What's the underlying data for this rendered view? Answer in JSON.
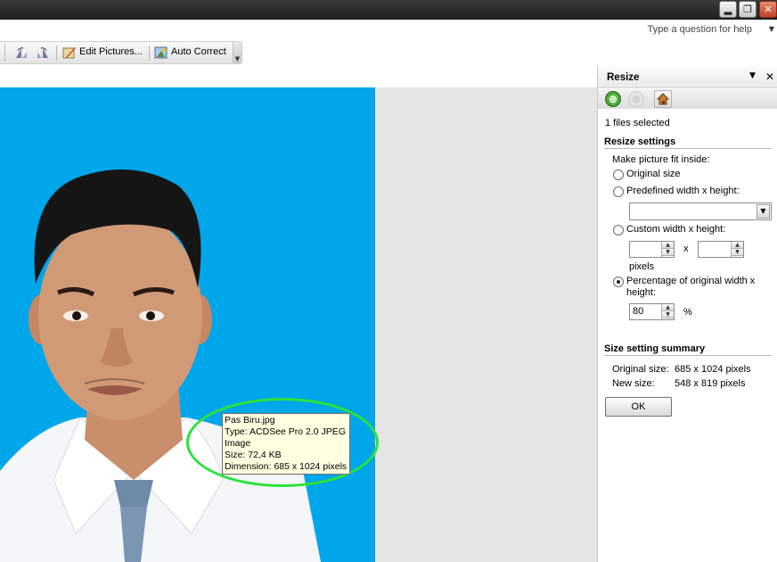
{
  "window": {
    "minimize_glyph": "▂",
    "restore_glyph": "❐",
    "close_glyph": "✕",
    "close_color": "#c5402a"
  },
  "menu": {
    "help_placeholder": "Type a question for help",
    "help_dropdown_glyph": "▼"
  },
  "toolbar": {
    "edit_pictures_label": "Edit Pictures...",
    "auto_correct_label": "Auto Correct",
    "icons": [
      "rotate-left-icon",
      "rotate-right-icon",
      "edit-pictures-icon",
      "auto-correct-icon"
    ]
  },
  "image": {
    "background_color": "#00a6ea",
    "tooltip": {
      "filename": "Pas Biru.jpg",
      "type": "Type: ACDSee Pro 2.0 JPEG",
      "type_cont": "Image",
      "size": "Size: 72,4 KB",
      "dimension": "Dimension: 685 x 1024 pixels"
    },
    "highlight_color": "#2de23a"
  },
  "task_pane": {
    "title": "Resize",
    "menu_glyph": "▼",
    "close_glyph": "✕",
    "nav": {
      "back_glyph": "⊕",
      "forward_glyph": "⊕",
      "home_icon": "home-icon"
    },
    "files_selected": "1 files selected",
    "resize_settings_heading": "Resize settings",
    "fit_inside_label": "Make picture fit inside:",
    "options": {
      "original_size": "Original size",
      "predefined": "Predefined width x height:",
      "custom": "Custom width x height:",
      "percentage": "Percentage of original width x",
      "percentage_cont": "height:"
    },
    "selected_option": "percentage",
    "custom": {
      "width": "",
      "height": "",
      "x_sep": "x",
      "unit": "pixels"
    },
    "percentage_value": "80",
    "percentage_unit": "%",
    "summary_heading": "Size setting summary",
    "original_size_label": "Original size:",
    "original_size_value": "685 x 1024 pixels",
    "new_size_label": "New size:",
    "new_size_value": "548 x 819 pixels",
    "ok_label": "OK"
  }
}
